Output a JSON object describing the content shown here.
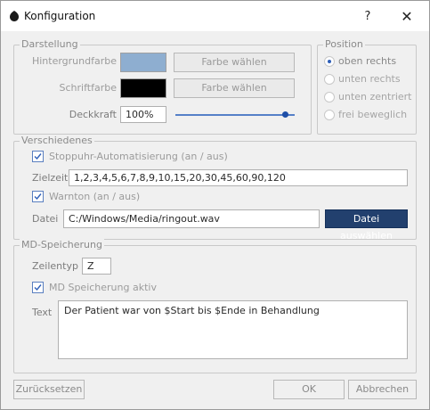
{
  "window": {
    "title": "Konfiguration",
    "help_label": "?",
    "close_label": "✕"
  },
  "darstellung": {
    "legend": "Darstellung",
    "hintergrund_label": "Hintergrundfarbe",
    "hintergrund_color": "#8eaed0",
    "hintergrund_button": "Farbe wählen",
    "schrift_label": "Schriftfarbe",
    "schrift_color": "#000000",
    "schrift_button": "Farbe wählen",
    "deckkraft_label": "Deckkraft",
    "deckkraft_value": "100%",
    "deckkraft_slider": 0.92
  },
  "position": {
    "legend": "Position",
    "options": [
      "oben rechts",
      "unten rechts",
      "unten zentriert",
      "frei beweglich"
    ],
    "selected": "oben rechts"
  },
  "verschiedenes": {
    "legend": "Verschiedenes",
    "stoppuhr_label": "Stoppuhr-Automatisierung (an / aus)",
    "stoppuhr_checked": true,
    "zielzeit_label": "Zielzeit",
    "zielzeit_value": "1,2,3,4,5,6,7,8,9,10,15,20,30,45,60,90,120",
    "warnton_label": "Warnton (an / aus)",
    "warnton_checked": true,
    "datei_label": "Datei",
    "datei_value": "C:/Windows/Media/ringout.wav",
    "datei_button": "Datei auswählen"
  },
  "md": {
    "legend": "MD-Speicherung",
    "zeilentyp_label": "Zeilentyp",
    "zeilentyp_value": "Z",
    "aktiv_label": "MD Speicherung aktiv",
    "aktiv_checked": true,
    "text_label": "Text",
    "text_value": "Der Patient war von $Start bis $Ende in Behandlung"
  },
  "footer": {
    "reset": "Zurücksetzen",
    "ok": "OK",
    "cancel": "Abbrechen"
  }
}
